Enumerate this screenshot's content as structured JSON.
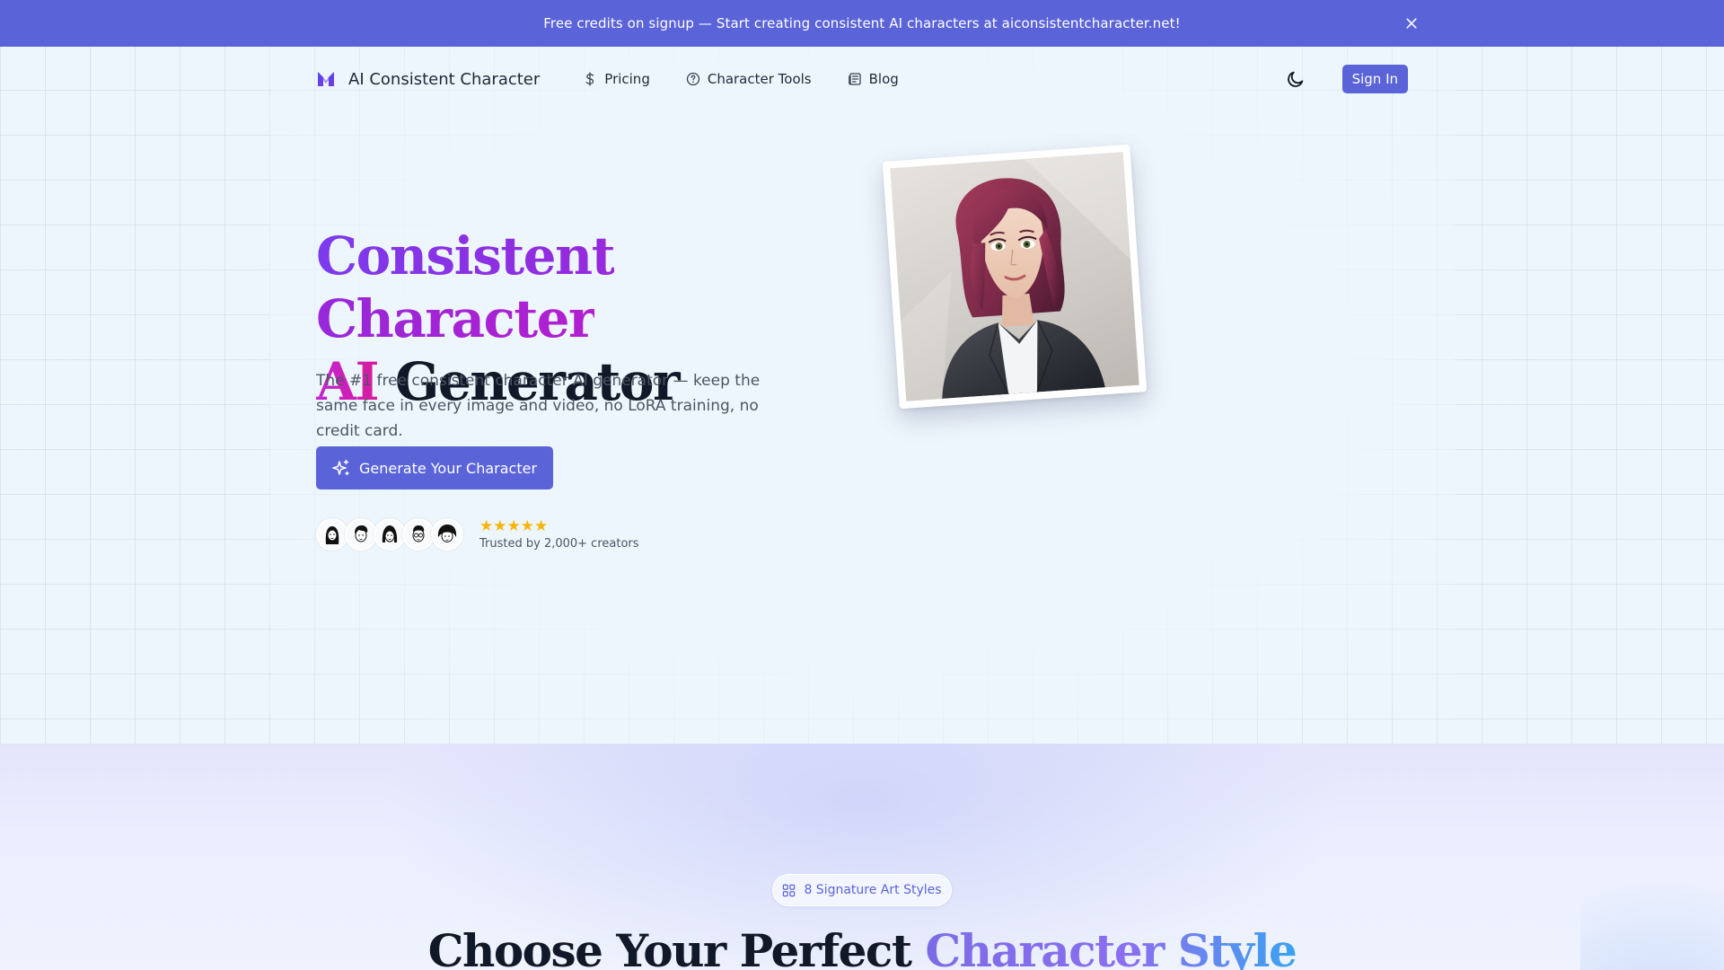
{
  "banner": {
    "text": "Free credits on signup — Start creating consistent AI characters at aiconsistentcharacter.net!",
    "close_icon": "close-icon"
  },
  "nav": {
    "brand": "AI Consistent Character",
    "links": [
      {
        "label": "Pricing",
        "icon": "dollar-icon"
      },
      {
        "label": "Character Tools",
        "icon": "help-circle-icon"
      },
      {
        "label": "Blog",
        "icon": "newspaper-icon"
      }
    ],
    "theme_icon": "moon-icon",
    "sign_in": "Sign In"
  },
  "hero": {
    "headline_part1": "Consistent Character",
    "headline_part2": "AI",
    "headline_part3": " Generator",
    "subtext": "The #1 free consistent character AI generator — keep the same face in every image and video, no LoRA training, no credit card.",
    "cta": "Generate Your Character",
    "rating_stars": 5,
    "stars": "★★★★★",
    "trusted": "Trusted by 2,000+ creators",
    "avatar_count": 5
  },
  "styles_section": {
    "pill": "8 Signature Art Styles",
    "title_part1": "Choose Your Perfect ",
    "title_part2": "Character Style"
  },
  "colors": {
    "brand": "#5a63d8",
    "gradient_purple": "#7c3aed",
    "gradient_magenta": "#c026d3",
    "star": "#f5b50a"
  }
}
